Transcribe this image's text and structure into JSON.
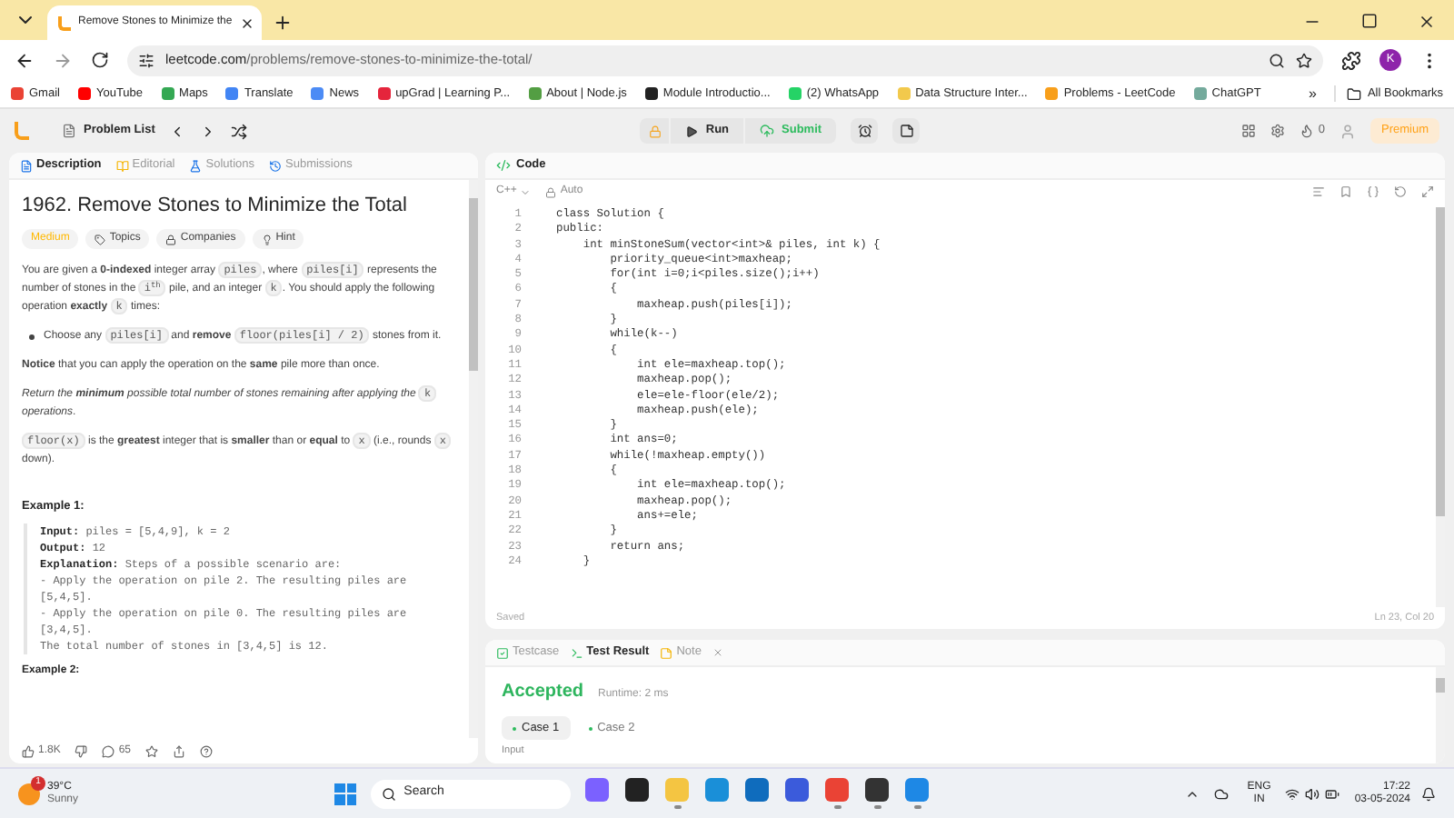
{
  "browser": {
    "tabs": [
      {
        "title": "Remove Stones to Minimize the",
        "selected": true
      }
    ],
    "url_host": "leetcode.com",
    "url_path": "/problems/remove-stones-to-minimize-the-total/",
    "profile_initial": "K"
  },
  "bookmarks": [
    {
      "label": "Gmail",
      "color": "#ea4335"
    },
    {
      "label": "YouTube",
      "color": "#ff0000"
    },
    {
      "label": "Maps",
      "color": "#34a853"
    },
    {
      "label": "Translate",
      "color": "#4285f4"
    },
    {
      "label": "News",
      "color": "#4c8bf5"
    },
    {
      "label": "upGrad | Learning P...",
      "color": "#e5253c"
    },
    {
      "label": "About | Node.js",
      "color": "#539e43"
    },
    {
      "label": "Module Introductio...",
      "color": "#222222"
    },
    {
      "label": "(2) WhatsApp",
      "color": "#25d366"
    },
    {
      "label": "Data Structure Inter...",
      "color": "#f2c94c"
    },
    {
      "label": "Problems - LeetCode",
      "color": "#f89f1b"
    },
    {
      "label": "ChatGPT",
      "color": "#74aa9c"
    }
  ],
  "bookmarks_more": "»",
  "all_bookmarks": "All Bookmarks",
  "nav": {
    "problem_list": "Problem List",
    "run": "Run",
    "submit": "Submit",
    "streak": "0",
    "premium": "Premium"
  },
  "desc_tabs": [
    {
      "label": "Description",
      "kind": "description",
      "selected": true
    },
    {
      "label": "Editorial",
      "kind": "editorial",
      "selected": false
    },
    {
      "label": "Solutions",
      "kind": "solutions",
      "selected": false
    },
    {
      "label": "Submissions",
      "kind": "submissions",
      "selected": false
    }
  ],
  "problem": {
    "title": "1962. Remove Stones to Minimize the Total",
    "difficulty": "Medium",
    "chips": [
      {
        "label": "Topics",
        "kind": "topics"
      },
      {
        "label": "Companies",
        "kind": "companies"
      },
      {
        "label": "Hint",
        "kind": "hint"
      }
    ],
    "paragraphs": [
      {
        "kind": "para",
        "segments": [
          {
            "kind": "text",
            "text": "You are given a **0-indexed** integer array "
          },
          {
            "kind": "code",
            "text": "piles"
          },
          {
            "kind": "text",
            "text": ", where "
          },
          {
            "kind": "code",
            "text": "piles[i]"
          },
          {
            "kind": "text",
            "text": " represents the number of stones in the "
          },
          {
            "kind": "code",
            "text": "i$^{th}$"
          },
          {
            "kind": "text",
            "text": " pile, and an integer "
          },
          {
            "kind": "code",
            "text": "k"
          },
          {
            "kind": "text",
            "text": ". You should apply the following operation **exactly** "
          },
          {
            "kind": "code",
            "text": "k"
          },
          {
            "kind": "text",
            "text": " times:"
          }
        ]
      },
      {
        "kind": "bullet",
        "segments": [
          {
            "kind": "text",
            "text": "Choose any "
          },
          {
            "kind": "code",
            "text": "piles[i]"
          },
          {
            "kind": "text",
            "text": " and **remove** "
          },
          {
            "kind": "code",
            "text": "floor(piles[i] / 2)"
          },
          {
            "kind": "text",
            "text": " stones from it."
          }
        ]
      },
      {
        "kind": "para",
        "segments": [
          {
            "kind": "text",
            "text": "**Notice** that you can apply the operation on the **same** pile more than once."
          }
        ]
      },
      {
        "kind": "para",
        "segments": [
          {
            "kind": "em",
            "text": "Return the **minimum** possible total number of stones remaining after applying the "
          },
          {
            "kind": "code",
            "text": "k"
          },
          {
            "kind": "em",
            "text": " operations"
          },
          {
            "kind": "text",
            "text": "."
          }
        ]
      },
      {
        "kind": "para",
        "segments": [
          {
            "kind": "code",
            "text": "floor(x)"
          },
          {
            "kind": "text",
            "text": " is the **greatest** integer that is **smaller** than or **equal** to "
          },
          {
            "kind": "code",
            "text": "x"
          },
          {
            "kind": "text",
            "text": " (i.e., rounds "
          },
          {
            "kind": "code",
            "text": "x"
          },
          {
            "kind": "text",
            "text": " down)."
          }
        ]
      }
    ],
    "example_title": "Example 1:",
    "example_lines": [
      "**Input:** piles = [5,4,9], k = 2",
      "**Output:** 12",
      "**Explanation:** Steps of a possible scenario are:",
      "- Apply the operation on pile 2. The resulting piles are [5,4,5].",
      "- Apply the operation on pile 0. The resulting piles are [3,4,5].",
      "The total number of stones in [3,4,5] is 12."
    ],
    "example2_title": "Example 2:",
    "likes": "1.8K",
    "comments": "65"
  },
  "code_panel": {
    "title": "Code",
    "language": "C++",
    "mode": "Auto",
    "lines": [
      "class Solution {",
      "public:",
      "    int minStoneSum(vector<int>& piles, int k) {",
      "        priority_queue<int>maxheap;",
      "        for(int i=0;i<piles.size();i++)",
      "        {",
      "            maxheap.push(piles[i]);",
      "        }",
      "        while(k--)",
      "        {",
      "            int ele=maxheap.top();",
      "            maxheap.pop();",
      "            ele=ele-floor(ele/2);",
      "            maxheap.push(ele);",
      "        }",
      "        int ans=0;",
      "        while(!maxheap.empty())",
      "        {",
      "            int ele=maxheap.top();",
      "            maxheap.pop();",
      "            ans+=ele;",
      "        }",
      "        return ans;",
      "    }"
    ],
    "line_numbers": [
      "1",
      "2",
      "3",
      "4",
      "5",
      "6",
      "7",
      "8",
      "9",
      "10",
      "11",
      "12",
      "13",
      "14",
      "15",
      "16",
      "17",
      "18",
      "19",
      "20",
      "21",
      "22",
      "23",
      "24"
    ],
    "status": "Saved",
    "cursor": "Ln 23, Col 20"
  },
  "result_panel": {
    "tabs": [
      {
        "label": "Testcase",
        "kind": "testcase",
        "selected": false
      },
      {
        "label": "Test Result",
        "kind": "result",
        "selected": true
      },
      {
        "label": "Note",
        "kind": "note",
        "selected": false
      }
    ],
    "verdict": "Accepted",
    "runtime": "Runtime: 2 ms",
    "cases": [
      {
        "label": "Case 1",
        "selected": true
      },
      {
        "label": "Case 2",
        "selected": false
      }
    ],
    "input_label": "Input"
  },
  "taskbar": {
    "temperature": "39°C",
    "weather": "Sunny",
    "badge": "1",
    "search": "Search",
    "apps": [
      {
        "color": "#7b61ff",
        "running": false
      },
      {
        "color": "#222222",
        "running": false
      },
      {
        "color": "#f4c542",
        "running": true
      },
      {
        "color": "#1a8fd8",
        "running": false
      },
      {
        "color": "#0f6cbd",
        "running": false
      },
      {
        "color": "#3b5bdb",
        "running": false
      },
      {
        "color": "#ea4335",
        "running": true
      },
      {
        "color": "#333333",
        "running": true
      },
      {
        "color": "#1e88e5",
        "running": true
      }
    ],
    "lang": "ENG",
    "region": "IN",
    "time": "17:22",
    "date": "03-05-2024"
  }
}
